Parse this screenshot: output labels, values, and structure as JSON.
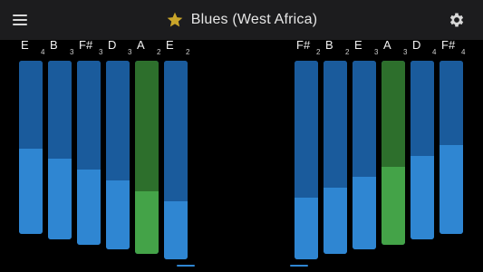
{
  "header": {
    "title": "Blues (West Africa)",
    "menu_icon": "hamburger-menu-icon",
    "favorite_icon": "star-icon",
    "settings_icon": "gear-icon",
    "star_color": "#c9a52a"
  },
  "colors": {
    "tine_top": "#1a5b9c",
    "tine_bottom": "#2f86d2",
    "highlight_top": "#2d6f2c",
    "highlight_bottom": "#44a348",
    "background": "#000000"
  },
  "left_tines": [
    {
      "note": "E",
      "octave": "4",
      "highlight": false
    },
    {
      "note": "B",
      "octave": "3",
      "highlight": false
    },
    {
      "note": "F#",
      "octave": "3",
      "highlight": false
    },
    {
      "note": "D",
      "octave": "3",
      "highlight": false
    },
    {
      "note": "A",
      "octave": "2",
      "highlight": true
    },
    {
      "note": "E",
      "octave": "2",
      "highlight": false
    }
  ],
  "right_tines": [
    {
      "note": "F#",
      "octave": "2",
      "highlight": false
    },
    {
      "note": "B",
      "octave": "2",
      "highlight": false
    },
    {
      "note": "E",
      "octave": "3",
      "highlight": false
    },
    {
      "note": "A",
      "octave": "3",
      "highlight": true
    },
    {
      "note": "D",
      "octave": "4",
      "highlight": false
    },
    {
      "note": "F#",
      "octave": "4",
      "highlight": false
    }
  ]
}
